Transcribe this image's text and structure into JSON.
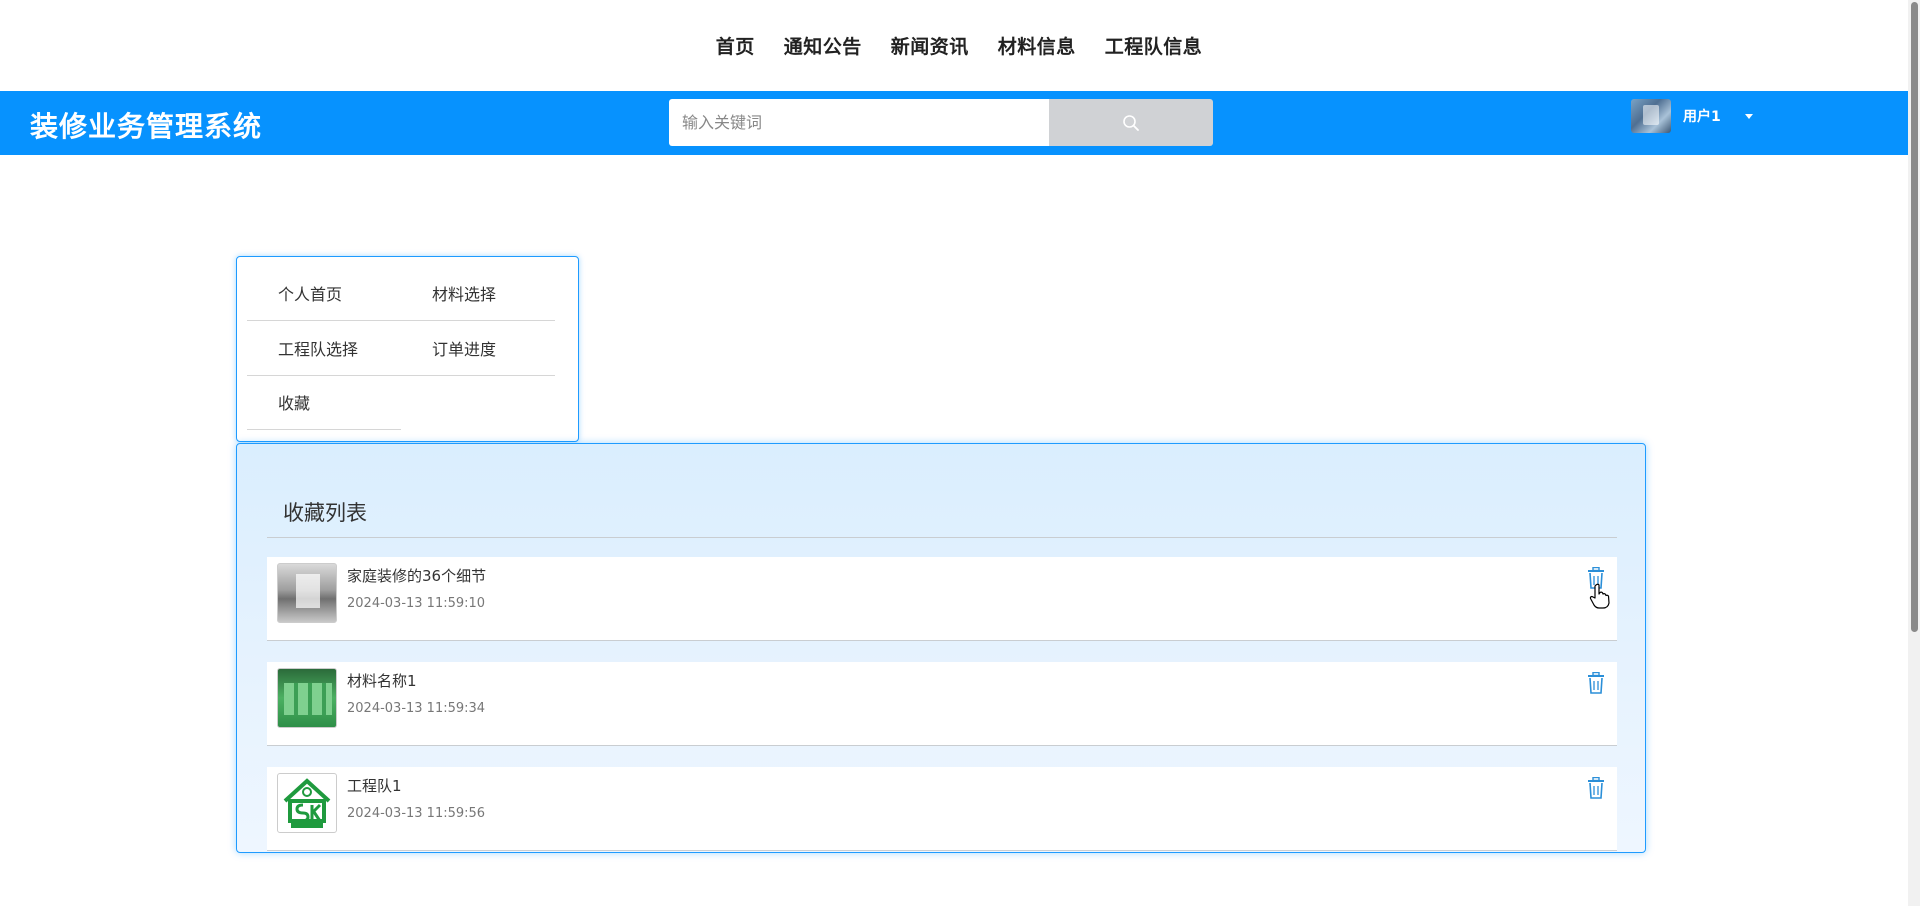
{
  "nav": {
    "items": [
      "首页",
      "通知公告",
      "新闻资讯",
      "材料信息",
      "工程队信息"
    ]
  },
  "header": {
    "brand": "装修业务管理系统",
    "search_placeholder": "输入关键词",
    "search_icon": "search-icon",
    "user_name": "用户1",
    "accent_color": "#0792fe"
  },
  "side_menu": {
    "items": [
      "个人首页",
      "材料选择",
      "工程队选择",
      "订单进度",
      "收藏"
    ]
  },
  "favorites": {
    "title": "收藏列表",
    "items": [
      {
        "title": "家庭装修的36个细节",
        "time": "2024-03-13 11:59:10",
        "thumb": "room-photo"
      },
      {
        "title": "材料名称1",
        "time": "2024-03-13 11:59:34",
        "thumb": "paint-buckets-photo"
      },
      {
        "title": "工程队1",
        "time": "2024-03-13 11:59:56",
        "thumb": "sk-logo"
      }
    ],
    "delete_icon": "trash-icon"
  }
}
